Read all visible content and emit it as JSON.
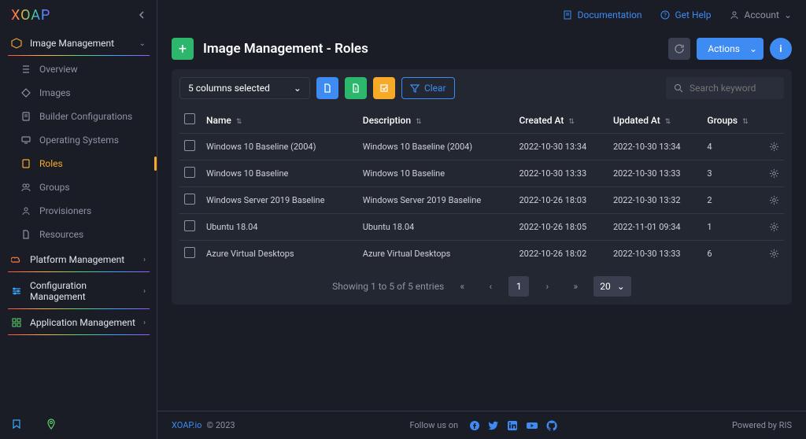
{
  "brand": "XOAP",
  "topbar": {
    "documentation": "Documentation",
    "help": "Get Help",
    "account": "Account"
  },
  "sidebar": {
    "sections": {
      "image": {
        "label": "Image Management",
        "items": {
          "overview": "Overview",
          "images": "Images",
          "builder": "Builder Configurations",
          "os": "Operating Systems",
          "roles": "Roles",
          "groups": "Groups",
          "provisioners": "Provisioners",
          "resources": "Resources"
        }
      },
      "platform": "Platform Management",
      "config": "Configuration Management",
      "app": "Application Management"
    }
  },
  "page": {
    "title": "Image Management - Roles",
    "actions_label": "Actions"
  },
  "toolbar": {
    "columns_selected": "5 columns selected",
    "clear": "Clear",
    "search_placeholder": "Search keyword"
  },
  "table": {
    "headers": {
      "name": "Name",
      "description": "Description",
      "created": "Created At",
      "updated": "Updated At",
      "groups": "Groups"
    },
    "rows": [
      {
        "name": "Windows 10 Baseline (2004)",
        "desc": "Windows 10 Baseline (2004)",
        "created": "2022-10-30 13:34",
        "updated": "2022-10-30 13:34",
        "groups": "4"
      },
      {
        "name": "Windows 10 Baseline",
        "desc": "Windows 10 Baseline",
        "created": "2022-10-30 13:33",
        "updated": "2022-10-30 13:33",
        "groups": "3"
      },
      {
        "name": "Windows Server 2019 Baseline",
        "desc": "Windows Server 2019 Baseline",
        "created": "2022-10-26 18:03",
        "updated": "2022-10-30 13:32",
        "groups": "2"
      },
      {
        "name": "Ubuntu 18.04",
        "desc": "Ubuntu 18.04",
        "created": "2022-10-26 18:05",
        "updated": "2022-11-01 09:34",
        "groups": "1"
      },
      {
        "name": "Azure Virtual Desktops",
        "desc": "Azure Virtual Desktops",
        "created": "2022-10-26 18:02",
        "updated": "2022-10-30 13:33",
        "groups": "6"
      }
    ]
  },
  "pagination": {
    "summary": "Showing 1 to 5 of 5 entries",
    "current": "1",
    "page_size": "20"
  },
  "footer": {
    "brand_link": "XOAP.io",
    "copyright": " © 2023",
    "follow": "Follow us on",
    "powered": "Powered by RIS"
  }
}
